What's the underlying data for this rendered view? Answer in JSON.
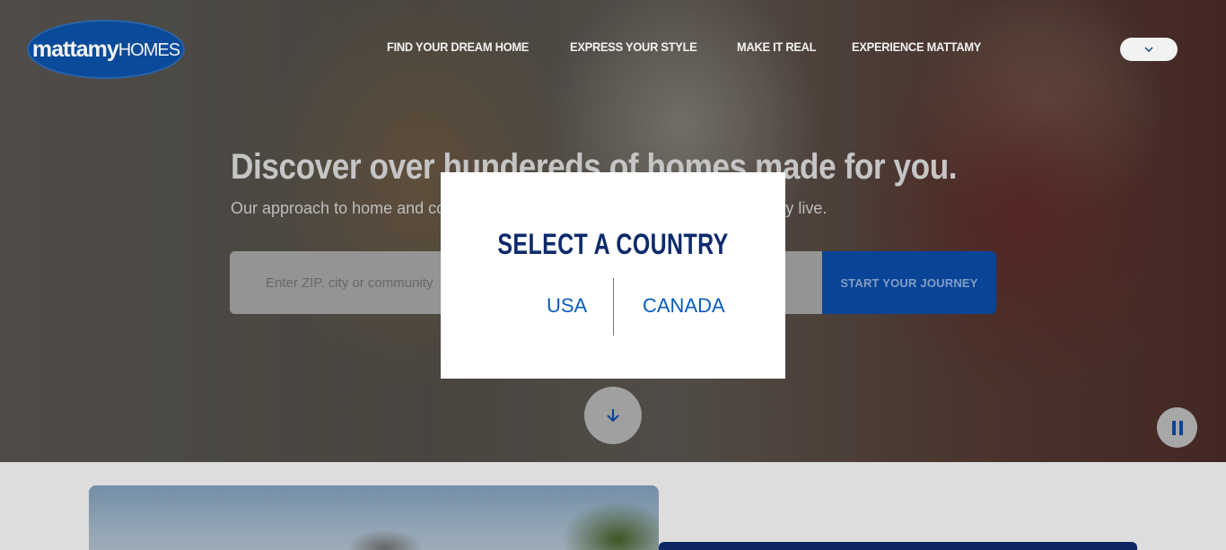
{
  "brand": {
    "logo_primary": "mattamy",
    "logo_secondary": "HOMES",
    "logo_color": "#0a4fa3"
  },
  "nav": {
    "items": [
      {
        "label": "FIND YOUR DREAM HOME"
      },
      {
        "label": "EXPRESS YOUR STYLE"
      },
      {
        "label": "MAKE IT REAL"
      },
      {
        "label": "EXPERIENCE MATTAMY"
      }
    ],
    "language_icon": "chevron-down-icon"
  },
  "hero": {
    "title": "Discover over hundereds of homes made for you.",
    "subtitle": "Our approach to home and community design, inspired by the way you already live.",
    "search_placeholder": "Enter ZIP, city or community",
    "cta_label": "START YOUR JOURNEY",
    "scroll_icon": "arrow-down-icon",
    "pause_icon": "pause-icon"
  },
  "modal": {
    "title": "SELECT A COUNTRY",
    "options": [
      {
        "label": "USA"
      },
      {
        "label": "CANADA"
      }
    ]
  },
  "colors": {
    "primary": "#0a48a0",
    "modal_title": "#0c2a6b",
    "link": "#0a5cbf"
  }
}
